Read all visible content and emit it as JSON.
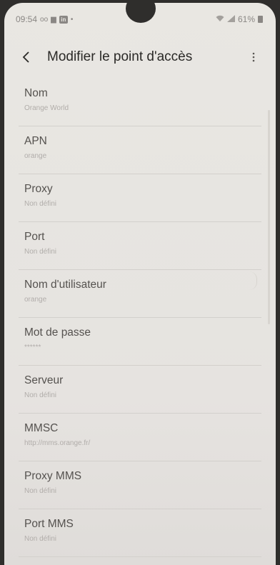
{
  "statusbar": {
    "time": "09:54",
    "left_icons": [
      "voicemail-icon",
      "notification-icon",
      "linkedin-icon",
      "dot-icon"
    ],
    "linkedin_glyph": "in",
    "right_icons": [
      "wifi-icon",
      "signal-icon",
      "battery-icon"
    ],
    "battery": "61%"
  },
  "header": {
    "title": "Modifier le point d'accès",
    "back_icon": "chevron-left-icon",
    "more_icon": "more-vert-icon"
  },
  "fields": [
    {
      "label": "Nom",
      "value": "Orange World"
    },
    {
      "label": "APN",
      "value": "orange"
    },
    {
      "label": "Proxy",
      "value": "Non défini"
    },
    {
      "label": "Port",
      "value": "Non défini"
    },
    {
      "label": "Nom d'utilisateur",
      "value": "orange"
    },
    {
      "label": "Mot de passe",
      "value": "******"
    },
    {
      "label": "Serveur",
      "value": "Non défini"
    },
    {
      "label": "MMSC",
      "value": "http://mms.orange.fr/"
    },
    {
      "label": "Proxy MMS",
      "value": "Non défini"
    },
    {
      "label": "Port MMS",
      "value": "Non défini"
    }
  ],
  "colors": {
    "background": "#e8e6e1",
    "title_text": "#2a2927",
    "label_text": "#55524f",
    "value_text": "#b1adaa",
    "divider": "#d3d0cc"
  }
}
